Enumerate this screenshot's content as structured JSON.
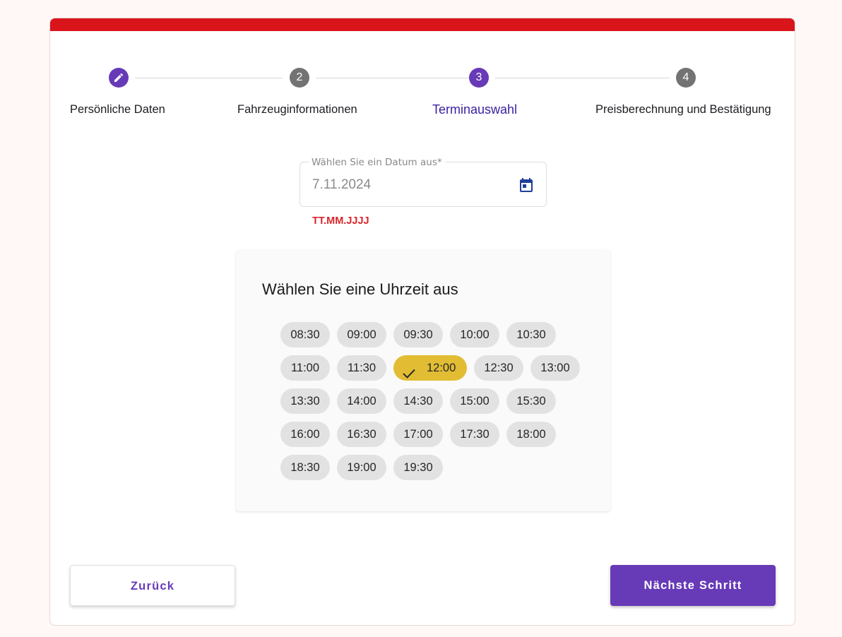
{
  "stepper": {
    "steps": [
      {
        "number": "1",
        "label": "Persönliche Daten",
        "state": "done",
        "icon": "pencil-icon"
      },
      {
        "number": "2",
        "label": "Fahrzeuginformationen",
        "state": "idle"
      },
      {
        "number": "3",
        "label": "Terminauswahl",
        "state": "active"
      },
      {
        "number": "4",
        "label": "Preisberechnung und Bestätigung",
        "state": "idle"
      }
    ]
  },
  "date_field": {
    "label": "Wählen Sie ein Datum aus*",
    "value": "7.11.2024",
    "hint": "TT.MM.JJJJ",
    "icon": "calendar-icon"
  },
  "time_picker": {
    "title": "Wählen Sie eine Uhrzeit aus",
    "selected": "12:00",
    "slots": [
      [
        "08:30",
        "09:00",
        "09:30",
        "10:00",
        "10:30"
      ],
      [
        "11:00",
        "11:30",
        "12:00",
        "12:30",
        "13:00"
      ],
      [
        "13:30",
        "14:00",
        "14:30",
        "15:00",
        "15:30"
      ],
      [
        "16:00",
        "16:30",
        "17:00",
        "17:30",
        "18:00"
      ],
      [
        "18:30",
        "19:00",
        "19:30"
      ]
    ]
  },
  "buttons": {
    "back_label": "Zurück",
    "next_label": "Nächste Schritt"
  },
  "colors": {
    "brand_red": "#da141b",
    "primary": "#673ab7",
    "selected_chip": "#e2bd34",
    "hint_red": "#d9262c"
  }
}
